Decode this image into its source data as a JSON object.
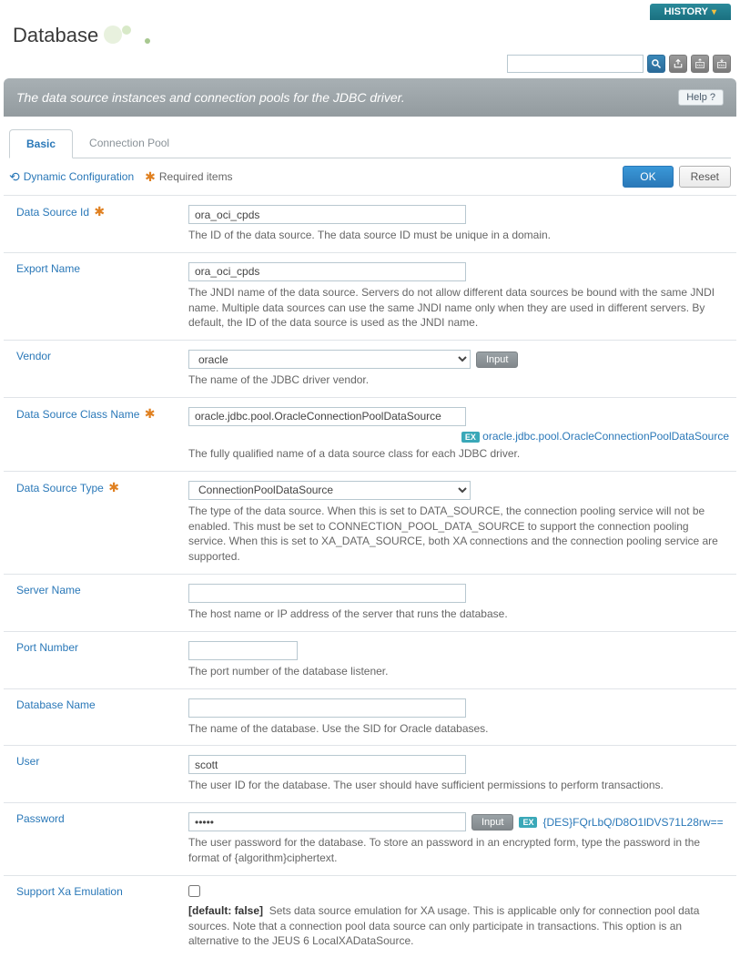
{
  "header": {
    "history_label": "HISTORY",
    "title": "Database"
  },
  "banner": {
    "text": "The data source instances and connection pools for the JDBC driver.",
    "help_label": "Help  ?"
  },
  "tabs": {
    "basic": "Basic",
    "connection_pool": "Connection Pool"
  },
  "toolbar": {
    "dynamic_config": "Dynamic Configuration",
    "required_items": "Required items",
    "ok": "OK",
    "reset": "Reset"
  },
  "buttons": {
    "input": "Input"
  },
  "fields": {
    "data_source_id": {
      "label": "Data Source Id",
      "value": "ora_oci_cpds",
      "desc": "The ID of the data source. The data source ID must be unique in a domain."
    },
    "export_name": {
      "label": "Export Name",
      "value": "ora_oci_cpds",
      "desc": "The JNDI name of the data source. Servers do not allow different data sources be bound with the same JNDI name. Multiple data sources can use the same JNDI name only when they are used in different servers. By default, the ID of the data source is used as the JNDI name."
    },
    "vendor": {
      "label": "Vendor",
      "value": "oracle",
      "desc": "The name of the JDBC driver vendor."
    },
    "ds_class": {
      "label": "Data Source Class Name",
      "value": "oracle.jdbc.pool.OracleConnectionPoolDataSource",
      "example": "oracle.jdbc.pool.OracleConnectionPoolDataSource",
      "desc": "The fully qualified name of a data source class for each JDBC driver."
    },
    "ds_type": {
      "label": "Data Source Type",
      "value": "ConnectionPoolDataSource",
      "desc": "The type of the data source. When this is set to DATA_SOURCE, the connection pooling service will not be enabled. This must be set to CONNECTION_POOL_DATA_SOURCE to support the connection pooling service. When this is set to XA_DATA_SOURCE, both XA connections and the connection pooling service are supported."
    },
    "server_name": {
      "label": "Server Name",
      "value": "",
      "desc": "The host name or IP address of the server that runs the database."
    },
    "port_number": {
      "label": "Port Number",
      "value": "",
      "desc": "The port number of the database listener."
    },
    "database_name": {
      "label": "Database Name",
      "value": "",
      "desc": "The name of the database. Use the SID for Oracle databases."
    },
    "user": {
      "label": "User",
      "value": "scott",
      "desc": "The user ID for the database. The user should have sufficient permissions to perform transactions."
    },
    "password": {
      "label": "Password",
      "value": "•••••",
      "example": "{DES}FQrLbQ/D8O1lDVS71L28rw==",
      "desc": "The user password for the database. To store an password in an encrypted form, type the password in the format of {algorithm}ciphertext."
    },
    "xa_emulation": {
      "label": "Support Xa Emulation",
      "default_tag": "[default: false]",
      "desc": "Sets data source emulation for XA usage. This is applicable only for connection pool data sources. Note that a connection pool data source can only participate in transactions. This option is an alternative to the JEUS 6 LocalXADataSource."
    }
  },
  "ex_label": "EX"
}
